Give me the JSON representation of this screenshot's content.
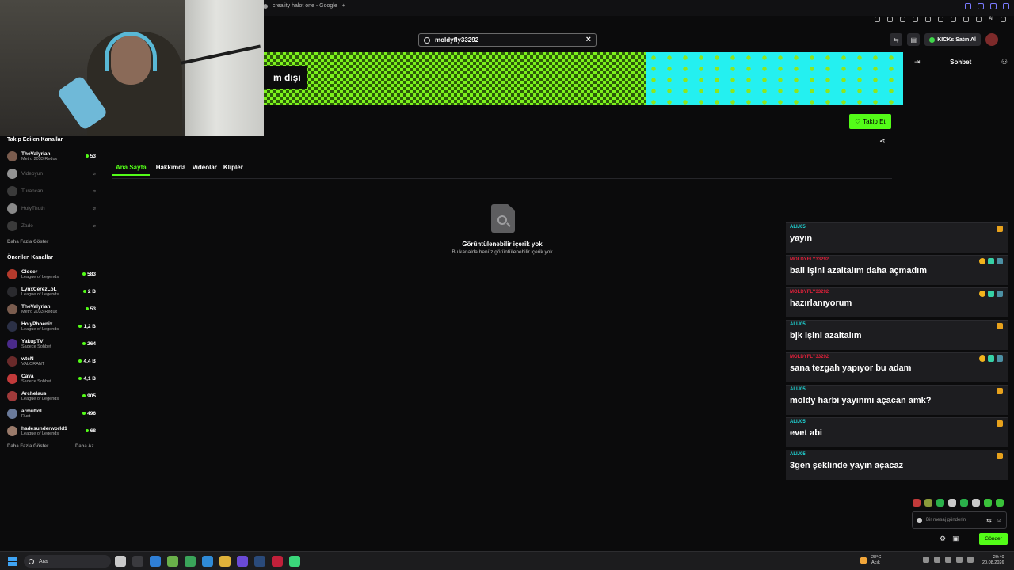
{
  "browser": {
    "tab_title": "creality halot one - Google",
    "ai_label": "AI"
  },
  "search": {
    "value": "moldyfly33292"
  },
  "header": {
    "kicks_label": "KICKs Satın Al",
    "chat_title": "Sohbet"
  },
  "banner": {
    "offline_text": "m dışı",
    "colors": {
      "green": "#7cf21c",
      "dark_green": "#2c5a0a",
      "cyan": "#24f0f0"
    }
  },
  "channel": {
    "follow_label": "Takip Et",
    "tabs": [
      {
        "label": "Ana Sayfa",
        "active": true
      },
      {
        "label": "Hakkımda",
        "active": false
      },
      {
        "label": "Videolar",
        "active": false
      },
      {
        "label": "Klipler",
        "active": false
      }
    ],
    "empty_title": "Görüntülenebilir içerik yok",
    "empty_sub": "Bu kanalda henüz görüntülenebilir içerik yok"
  },
  "sidebar": {
    "followed_title": "Takip Edilen Kanallar",
    "followed": [
      {
        "name": "TheValyrian",
        "game": "Metro 2033 Redux",
        "viewers": "53",
        "live": true
      },
      {
        "name": "Videoyun",
        "game": "",
        "viewers": "",
        "live": false
      },
      {
        "name": "Turancan",
        "game": "",
        "viewers": "",
        "live": false
      },
      {
        "name": "HolyThoth",
        "game": "",
        "viewers": "",
        "live": false
      },
      {
        "name": "Zade",
        "game": "",
        "viewers": "",
        "live": false
      }
    ],
    "followed_more": "Daha Fazla Göster",
    "recommended_title": "Önerilen Kanallar",
    "recommended": [
      {
        "name": "Closer",
        "game": "League of Legends",
        "viewers": "583"
      },
      {
        "name": "LynxCerezLoL",
        "game": "League of Legends",
        "viewers": "2 B"
      },
      {
        "name": "TheValyrian",
        "game": "Metro 2033 Redux",
        "viewers": "53"
      },
      {
        "name": "HolyPhoenix",
        "game": "League of Legends",
        "viewers": "1,2 B"
      },
      {
        "name": "YakupTV",
        "game": "Sadece Sohbet",
        "viewers": "264"
      },
      {
        "name": "wtcN",
        "game": "VALORANT",
        "viewers": "4,4 B"
      },
      {
        "name": "Cava",
        "game": "Sadece Sohbet",
        "viewers": "4,1 B"
      },
      {
        "name": "Archelaus",
        "game": "League of Legends",
        "viewers": "905"
      },
      {
        "name": "armutlol",
        "game": "Rust",
        "viewers": "496"
      },
      {
        "name": "hadesunderworld1",
        "game": "League of Legends",
        "viewers": "68"
      }
    ],
    "rec_more": "Daha Fazla Göster",
    "rec_less": "Daha Az"
  },
  "chat": {
    "messages": [
      {
        "user": "ALIJ05",
        "color": "#1fd6d6",
        "text": "yayın",
        "badges": [
          "crown"
        ]
      },
      {
        "user": "MOLDYFLY33292",
        "color": "#e0203a",
        "text": "bali işini azaltalım daha açmadım",
        "badges": [
          "coin",
          "gift",
          "sub"
        ]
      },
      {
        "user": "MOLDYFLY33292",
        "color": "#e0203a",
        "text": "hazırlanıyorum",
        "badges": [
          "coin",
          "gift",
          "sub"
        ]
      },
      {
        "user": "ALIJ05",
        "color": "#1fd6d6",
        "text": "bjk işini azaltalım",
        "badges": [
          "crown"
        ]
      },
      {
        "user": "MOLDYFLY33292",
        "color": "#e0203a",
        "text": "sana tezgah yapıyor bu adam",
        "badges": [
          "coin",
          "gift",
          "sub"
        ]
      },
      {
        "user": "ALIJ05",
        "color": "#1fd6d6",
        "text": "moldy harbi yayınmı açacan amk?",
        "badges": [
          "crown"
        ]
      },
      {
        "user": "ALIJ05",
        "color": "#1fd6d6",
        "text": "evet abi",
        "badges": [
          "crown"
        ]
      },
      {
        "user": "ALIJ05",
        "color": "#1fd6d6",
        "text": "3gen şeklinde yayın açacaz",
        "badges": [
          "crown"
        ]
      }
    ],
    "input_placeholder": "Bir mesaj gönderin",
    "send_label": "Gönder"
  },
  "taskbar": {
    "search_label": "Ara",
    "weather_temp": "28°C",
    "weather_desc": "Açık",
    "time": "20:40",
    "date": "20.08.2026"
  }
}
